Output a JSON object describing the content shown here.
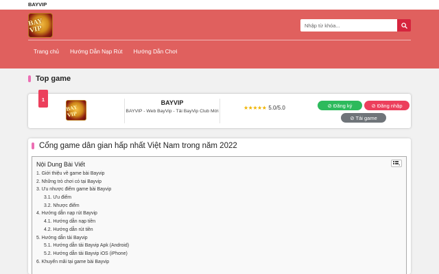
{
  "site": {
    "name": "BAYVIP",
    "logo_text": "BAY VIP"
  },
  "search": {
    "placeholder": "Nhập từ khóa..."
  },
  "nav": {
    "items": [
      {
        "label": "Trang chủ"
      },
      {
        "label": "Hướng Dẫn Nạp Rút"
      },
      {
        "label": "Hướng Dẫn Chơi"
      }
    ]
  },
  "top_game": {
    "section_title": "Top game",
    "rank": "1",
    "name": "BAYVIP",
    "description": "BAYVIP - Web BayVip - Tải BayVip Club Mới",
    "stars": "★★★★★",
    "rating": "5.0/5.0",
    "buttons": {
      "register": "⊘ Đăng ký",
      "login": "⊘ Đăng nhập",
      "download": "⊘ Tải game"
    }
  },
  "article": {
    "title": "Cổng game dân gian hấp nhất Việt Nam trong năm 2022",
    "toc": {
      "title": "Nội Dung Bài Viết",
      "items": [
        {
          "label": "1. Giới thiệu về game bài Bayvip",
          "level": 1
        },
        {
          "label": "2. Những trò chơi có tại Bayvip",
          "level": 1
        },
        {
          "label": "3. Ưu nhược điểm game bài Bayvip",
          "level": 1
        },
        {
          "label": "3.1. Ưu điểm",
          "level": 2
        },
        {
          "label": "3.2. Nhược điểm",
          "level": 2
        },
        {
          "label": "4. Hướng dẫn nạp rút Bayvip",
          "level": 1
        },
        {
          "label": "4.1. Hướng dẫn nạp tiền",
          "level": 2
        },
        {
          "label": "4.2. Hướng dẫn rút tiền",
          "level": 2
        },
        {
          "label": "5. Hướng dẫn tải Bayvip",
          "level": 1
        },
        {
          "label": "5.1. Hướng dẫn tải Bayvip Apk (Android)",
          "level": 2
        },
        {
          "label": "5.2. Hướng dẫn tải Bayvip iOS (iPhone)",
          "level": 2
        },
        {
          "label": "6. Khuyến mãi tại game bài Bayvip",
          "level": 1
        }
      ]
    }
  },
  "colors": {
    "header_bg": "#e0605e",
    "accent_pink": "#ec6fb4",
    "search_button": "#d6243e",
    "register_green": "#2dba5c",
    "login_red": "#ec3f5c",
    "download_gray": "#6f7479",
    "star_gold": "#f0b400"
  },
  "icons": {
    "search": "search-icon",
    "toc_toggle": "list-toggle-icon"
  }
}
